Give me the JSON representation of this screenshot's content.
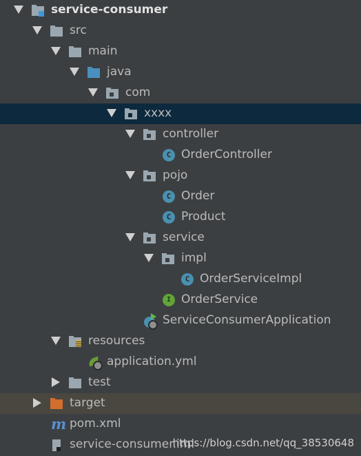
{
  "tree": {
    "root": "service-consumer",
    "src": "src",
    "main": "main",
    "java": "java",
    "com": "com",
    "xxxx": "xxxx",
    "controller": "controller",
    "order_controller": "OrderController",
    "pojo": "pojo",
    "order": "Order",
    "product": "Product",
    "service": "service",
    "impl": "impl",
    "order_service_impl": "OrderServiceImpl",
    "order_service": "OrderService",
    "app": "ServiceConsumerApplication",
    "resources": "resources",
    "application_yml": "application.yml",
    "test": "test",
    "target": "target",
    "pom": "pom.xml",
    "iml": "service-consumer.iml"
  },
  "icons": {
    "class_letter": "C",
    "interface_letter": "I",
    "maven_letter": "m"
  },
  "watermark": "https://blog.csdn.net/qq_38530648",
  "colors": {
    "background": "#3c3f41",
    "selected_row": "#0d293e",
    "excluded_row": "#49473f",
    "text": "#bbbbbb"
  }
}
